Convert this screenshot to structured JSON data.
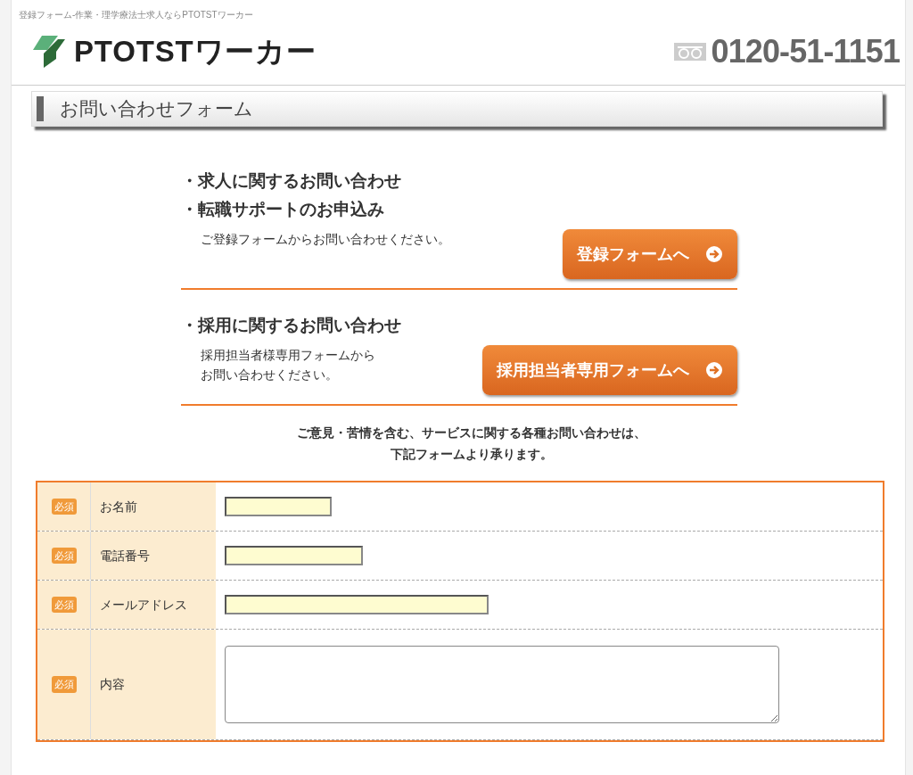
{
  "tagline": "登録フォーム-作業・理学療法士求人ならPTOTSTワーカー",
  "logo": {
    "text": "PTOTSTワーカー"
  },
  "phone": "0120-51-1151",
  "section_title": "お問い合わせフォーム",
  "blocks": [
    {
      "headings": [
        "・求人に関するお問い合わせ",
        "・転職サポートのお申込み"
      ],
      "lines": [
        "ご登録フォームからお問い合わせください。"
      ],
      "button": "登録フォームへ"
    },
    {
      "headings": [
        "・採用に関するお問い合わせ"
      ],
      "lines": [
        "採用担当者様専用フォームから",
        "お問い合わせください。"
      ],
      "button": "採用担当者専用フォームへ"
    }
  ],
  "notice": [
    "ご意見・苦情を含む、サービスに関する各種お問い合わせは、",
    "下記フォームより承ります。"
  ],
  "form_rows": [
    {
      "required": true,
      "badge": "必須",
      "label": "お名前",
      "kind": "short"
    },
    {
      "required": true,
      "badge": "必須",
      "label": "電話番号",
      "kind": "medium"
    },
    {
      "required": true,
      "badge": "必須",
      "label": "メールアドレス",
      "kind": "long"
    },
    {
      "required": true,
      "badge": "必須",
      "label": "内容",
      "kind": "textarea"
    }
  ]
}
